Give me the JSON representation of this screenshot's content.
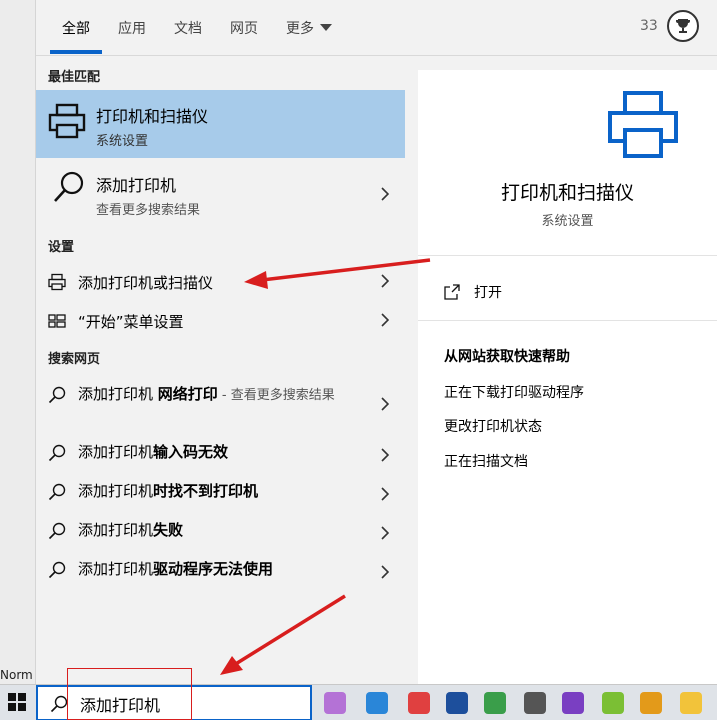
{
  "left_strip": {
    "visible_text": "Norm"
  },
  "tabs": [
    {
      "label": "全部",
      "active": true
    },
    {
      "label": "应用",
      "active": false
    },
    {
      "label": "文档",
      "active": false
    },
    {
      "label": "网页",
      "active": false
    },
    {
      "label": "更多",
      "active": false
    }
  ],
  "header": {
    "count": "33",
    "trophy_icon": "trophy-icon"
  },
  "sections": {
    "best_match": "最佳匹配",
    "settings": "设置",
    "web_search": "搜索网页"
  },
  "best_match": {
    "title": "打印机和扫描仪",
    "subtitle": "系统设置",
    "icon": "printer-icon"
  },
  "add_printer": {
    "title": "添加打印机",
    "subtitle": "查看更多搜索结果",
    "icon": "search-icon"
  },
  "settings_items": [
    {
      "label": "添加打印机或扫描仪",
      "icon": "printer-small-icon"
    },
    {
      "label": "“开始”菜单设置",
      "icon": "start-menu-icon"
    }
  ],
  "web_items": [
    {
      "prefix": "添加打印机 ",
      "bold": "网络打印",
      "suffix": " - 查看更多搜索结果"
    },
    {
      "prefix": "添加打印机",
      "bold": "输入码无效",
      "suffix": ""
    },
    {
      "prefix": "添加打印机",
      "bold": "时找不到打印机",
      "suffix": ""
    },
    {
      "prefix": "添加打印机",
      "bold": "失败",
      "suffix": ""
    },
    {
      "prefix": "添加打印机",
      "bold": "驱动程序无法使用",
      "suffix": ""
    }
  ],
  "detail": {
    "title": "打印机和扫描仪",
    "subtitle": "系统设置",
    "open_label": "打开",
    "help_title": "从网站获取快速帮助",
    "help_links": [
      "正在下载打印驱动程序",
      "更改打印机状态",
      "正在扫描文档"
    ]
  },
  "taskbar": {
    "search_value": "添加打印机"
  },
  "colors": {
    "accent": "#0a63c9",
    "selected_bg": "#a7cbea",
    "annotation_red": "#d81e1e"
  }
}
